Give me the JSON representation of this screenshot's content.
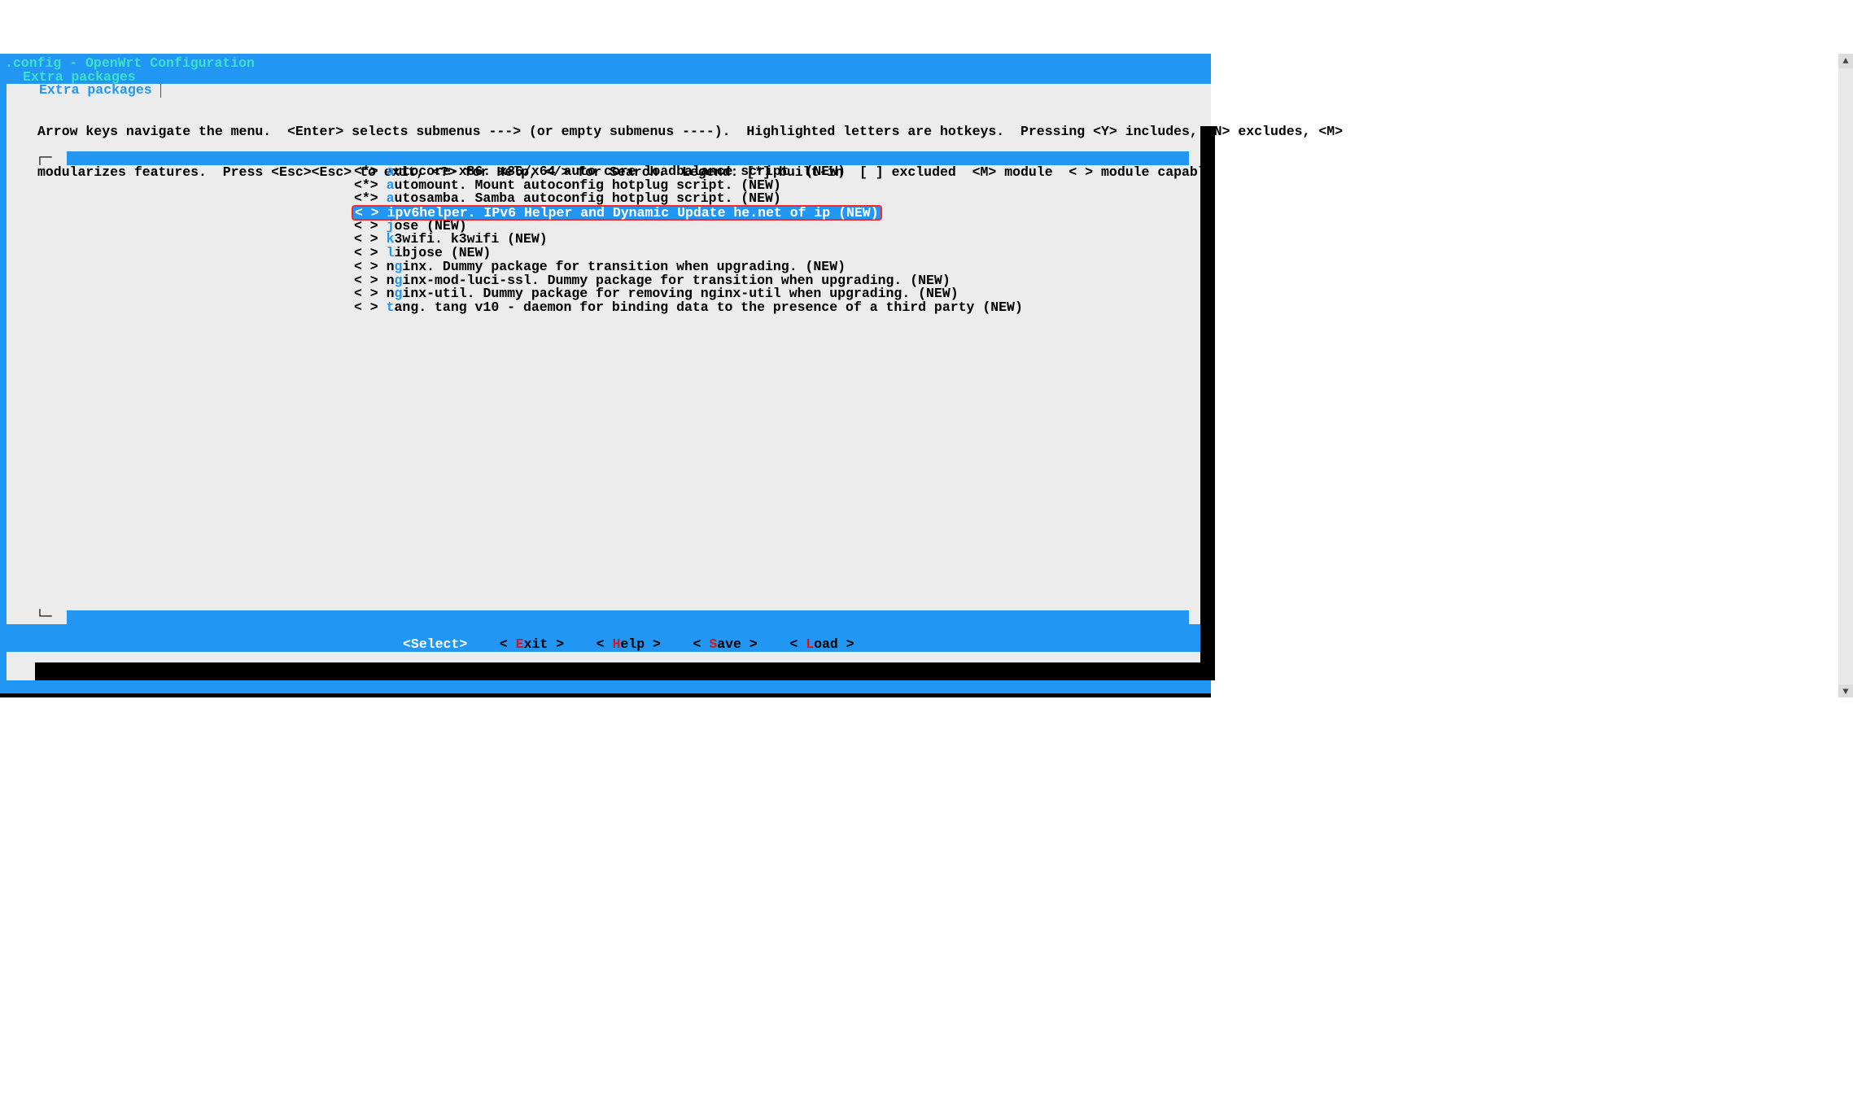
{
  "title_main": ".config - OpenWrt Configuration",
  "title_path": "Extra packages",
  "tab_label": "Extra packages",
  "instructions": [
    "Arrow keys navigate the menu.  <Enter> selects submenus ---> (or empty submenus ----).  Highlighted letters are hotkeys.  Pressing <Y> includes, <N> excludes, <M>",
    "modularizes features.  Press <Esc><Esc> to exit, <?> for Help, </> for Search.  Legend: [*] built-in  [ ] excluded  <M> module  < > module capable"
  ],
  "items": [
    {
      "mark": "<*>",
      "hot": "a",
      "rest": "utocore-x86. x86/x64 auto core loadbalance script. (NEW)",
      "selected": false
    },
    {
      "mark": "<*>",
      "hot": "a",
      "rest": "utomount. Mount autoconfig hotplug script. (NEW)",
      "selected": false
    },
    {
      "mark": "<*>",
      "hot": "a",
      "rest": "utosamba. Samba autoconfig hotplug script. (NEW)",
      "selected": false
    },
    {
      "mark": "< >",
      "hot": "i",
      "rest": "pv6helper. IPv6 Helper and Dynamic Update he.net of ip (NEW)",
      "selected": true
    },
    {
      "mark": "< >",
      "hot": "j",
      "rest": "ose (NEW)",
      "selected": false
    },
    {
      "mark": "< >",
      "hot": "k",
      "rest": "3wifi. k3wifi (NEW)",
      "selected": false
    },
    {
      "mark": "< >",
      "hot": "l",
      "rest": "ibjose (NEW)",
      "selected": false
    },
    {
      "mark": "< >",
      "hot": "n",
      "rest": "ginx. Dummy package for transition when upgrading. (NEW)",
      "selected": false,
      "hot_c": "g"
    },
    {
      "mark": "< >",
      "hot": "n",
      "rest": "ginx-mod-luci-ssl. Dummy package for transition when upgrading. (NEW)",
      "selected": false,
      "hot_c": "g"
    },
    {
      "mark": "< >",
      "hot": "n",
      "rest": "ginx-util. Dummy package for removing nginx-util when upgrading. (NEW)",
      "selected": false,
      "hot_c": "g"
    },
    {
      "mark": "< >",
      "hot": "t",
      "rest": "ang. tang v10 - daemon for binding data to the presence of a third party (NEW)",
      "selected": false
    }
  ],
  "buttons": [
    {
      "label": "Select",
      "hot": "S",
      "selected": true
    },
    {
      "label": "Exit",
      "hot": "E",
      "selected": false
    },
    {
      "label": "Help",
      "hot": "H",
      "selected": false
    },
    {
      "label": "Save",
      "hot": "S",
      "selected": false
    },
    {
      "label": "Load",
      "hot": "L",
      "selected": false
    }
  ]
}
